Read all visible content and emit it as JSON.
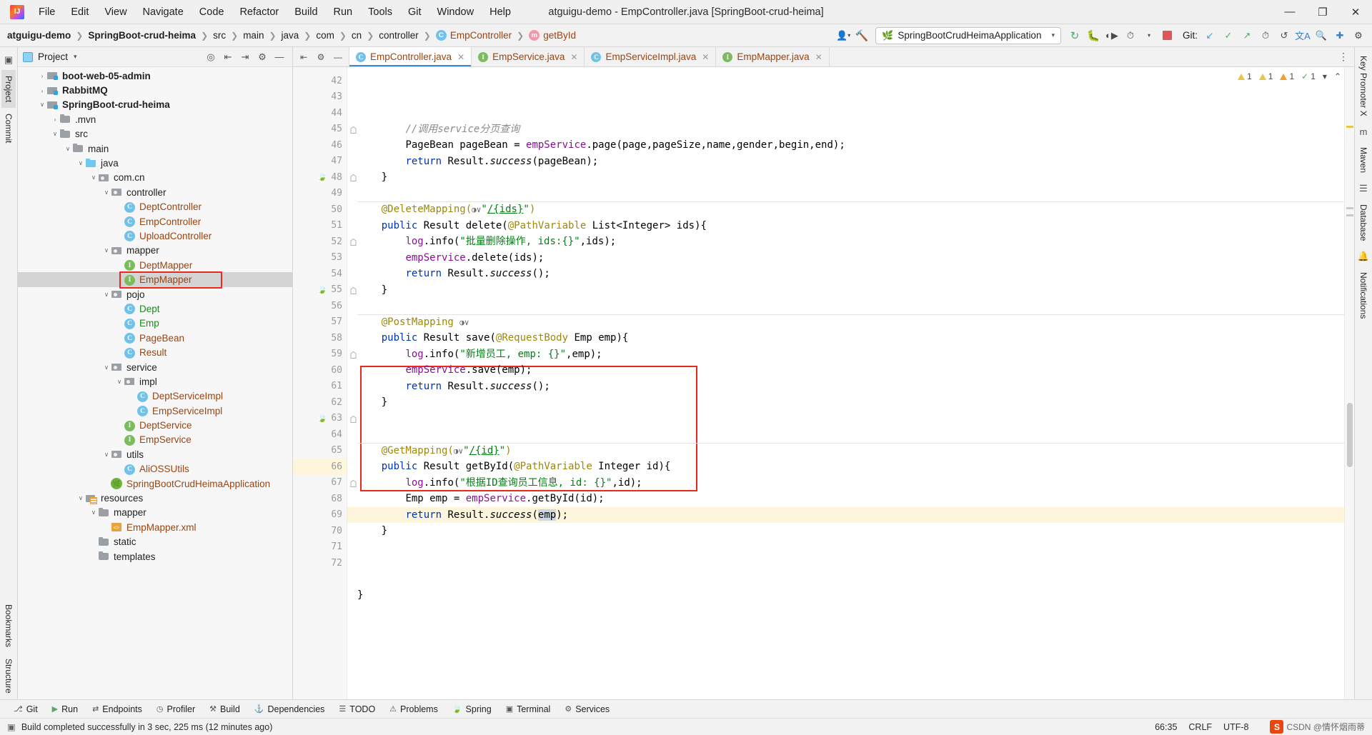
{
  "window": {
    "title": "atguigu-demo - EmpController.java [SpringBoot-crud-heima]",
    "minimize": "—",
    "maximize": "❐",
    "close": "✕"
  },
  "menubar": [
    {
      "label": "File"
    },
    {
      "label": "Edit"
    },
    {
      "label": "View"
    },
    {
      "label": "Navigate"
    },
    {
      "label": "Code"
    },
    {
      "label": "Refactor"
    },
    {
      "label": "Build"
    },
    {
      "label": "Run"
    },
    {
      "label": "Tools"
    },
    {
      "label": "Git"
    },
    {
      "label": "Window"
    },
    {
      "label": "Help"
    }
  ],
  "breadcrumb": [
    {
      "label": "atguigu-demo",
      "bold": true,
      "badge": ""
    },
    {
      "label": "SpringBoot-crud-heima",
      "bold": true,
      "badge": ""
    },
    {
      "label": "src",
      "bold": false,
      "badge": ""
    },
    {
      "label": "main",
      "bold": false,
      "badge": ""
    },
    {
      "label": "java",
      "bold": false,
      "badge": ""
    },
    {
      "label": "com",
      "bold": false,
      "badge": ""
    },
    {
      "label": "cn",
      "bold": false,
      "badge": ""
    },
    {
      "label": "controller",
      "bold": false,
      "badge": ""
    },
    {
      "label": "EmpController",
      "bold": false,
      "badge": "C"
    },
    {
      "label": "getById",
      "bold": false,
      "badge": "m"
    }
  ],
  "toolbar": {
    "run_config": "SpringBootCrudHeimaApplication",
    "git_label": "Git:",
    "icons": {
      "user": "user-icon",
      "hammer": "build-icon",
      "rerun": "rerun-icon",
      "debug": "debug-icon",
      "coverage": "coverage-icon",
      "profiler": "profiler-icon",
      "stop": "stop-icon",
      "update": "git-update-icon",
      "commit": "git-commit-icon",
      "push": "git-push-icon",
      "history": "git-history-icon",
      "rollback": "git-rollback-icon",
      "translate": "translate-icon",
      "search": "search-icon",
      "plugin": "plugins-icon",
      "settings": "settings-icon"
    }
  },
  "left_rail": [
    "Project",
    "Commit"
  ],
  "right_rail": [
    "Key Promoter X",
    "Maven",
    "Database",
    "Notifications"
  ],
  "bottom_rail": [
    "Bookmarks",
    "Structure"
  ],
  "project_panel": {
    "title": "Project",
    "tree": [
      {
        "depth": 1,
        "arrow": "›",
        "icon": "module",
        "label": "boot-web-05-admin",
        "style": "b"
      },
      {
        "depth": 1,
        "arrow": "›",
        "icon": "module",
        "label": "RabbitMQ",
        "style": "b"
      },
      {
        "depth": 1,
        "arrow": "∨",
        "icon": "module",
        "label": "SpringBoot-crud-heima",
        "style": "b"
      },
      {
        "depth": 2,
        "arrow": "›",
        "icon": "folder",
        "label": ".mvn",
        "style": ""
      },
      {
        "depth": 2,
        "arrow": "∨",
        "icon": "folder",
        "label": "src",
        "style": ""
      },
      {
        "depth": 3,
        "arrow": "∨",
        "icon": "folder",
        "label": "main",
        "style": ""
      },
      {
        "depth": 4,
        "arrow": "∨",
        "icon": "folder-blue",
        "label": "java",
        "style": ""
      },
      {
        "depth": 5,
        "arrow": "∨",
        "icon": "package",
        "label": "com.cn",
        "style": ""
      },
      {
        "depth": 6,
        "arrow": "∨",
        "icon": "package",
        "label": "controller",
        "style": ""
      },
      {
        "depth": 7,
        "arrow": "",
        "icon": "class",
        "label": "DeptController",
        "style": "orange"
      },
      {
        "depth": 7,
        "arrow": "",
        "icon": "class",
        "label": "EmpController",
        "style": "orange"
      },
      {
        "depth": 7,
        "arrow": "",
        "icon": "class",
        "label": "UploadController",
        "style": "orange"
      },
      {
        "depth": 6,
        "arrow": "∨",
        "icon": "package",
        "label": "mapper",
        "style": ""
      },
      {
        "depth": 7,
        "arrow": "",
        "icon": "interface",
        "label": "DeptMapper",
        "style": "orange"
      },
      {
        "depth": 7,
        "arrow": "",
        "icon": "interface",
        "label": "EmpMapper",
        "style": "orange",
        "selected": true,
        "boxed": true
      },
      {
        "depth": 6,
        "arrow": "∨",
        "icon": "package",
        "label": "pojo",
        "style": ""
      },
      {
        "depth": 7,
        "arrow": "",
        "icon": "class",
        "label": "Dept",
        "style": "green"
      },
      {
        "depth": 7,
        "arrow": "",
        "icon": "class",
        "label": "Emp",
        "style": "green"
      },
      {
        "depth": 7,
        "arrow": "",
        "icon": "class",
        "label": "PageBean",
        "style": "orange"
      },
      {
        "depth": 7,
        "arrow": "",
        "icon": "class",
        "label": "Result",
        "style": "orange"
      },
      {
        "depth": 6,
        "arrow": "∨",
        "icon": "package",
        "label": "service",
        "style": ""
      },
      {
        "depth": 7,
        "arrow": "∨",
        "icon": "package",
        "label": "impl",
        "style": ""
      },
      {
        "depth": 8,
        "arrow": "",
        "icon": "class",
        "label": "DeptServiceImpl",
        "style": "orange"
      },
      {
        "depth": 8,
        "arrow": "",
        "icon": "class",
        "label": "EmpServiceImpl",
        "style": "orange"
      },
      {
        "depth": 7,
        "arrow": "",
        "icon": "interface",
        "label": "DeptService",
        "style": "orange"
      },
      {
        "depth": 7,
        "arrow": "",
        "icon": "interface",
        "label": "EmpService",
        "style": "orange"
      },
      {
        "depth": 6,
        "arrow": "∨",
        "icon": "package",
        "label": "utils",
        "style": ""
      },
      {
        "depth": 7,
        "arrow": "",
        "icon": "class",
        "label": "AliOSSUtils",
        "style": "orange"
      },
      {
        "depth": 6,
        "arrow": "",
        "icon": "spring-app",
        "label": "SpringBootCrudHeimaApplication",
        "style": "orange"
      },
      {
        "depth": 4,
        "arrow": "∨",
        "icon": "resources",
        "label": "resources",
        "style": ""
      },
      {
        "depth": 5,
        "arrow": "∨",
        "icon": "folder",
        "label": "mapper",
        "style": ""
      },
      {
        "depth": 6,
        "arrow": "",
        "icon": "xml",
        "label": "EmpMapper.xml",
        "style": "orange"
      },
      {
        "depth": 5,
        "arrow": "",
        "icon": "folder",
        "label": "static",
        "style": ""
      },
      {
        "depth": 5,
        "arrow": "",
        "icon": "folder",
        "label": "templates",
        "style": ""
      }
    ]
  },
  "editor": {
    "tabs": [
      {
        "label": "EmpController.java",
        "badge": "C",
        "badge_type": "class",
        "active": true
      },
      {
        "label": "EmpService.java",
        "badge": "I",
        "badge_type": "interface",
        "active": false
      },
      {
        "label": "EmpServiceImpl.java",
        "badge": "C",
        "badge_type": "class",
        "active": false
      },
      {
        "label": "EmpMapper.java",
        "badge": "I",
        "badge_type": "interface",
        "active": false
      }
    ],
    "inspection": {
      "warnings": "1",
      "weak_warnings": "1",
      "typos": "1",
      "checks": "1"
    },
    "first_line": 42,
    "lines": [
      {
        "n": 42,
        "indent": 8,
        "tokens": [
          {
            "t": "//调用service分页查询",
            "c": "cmt"
          }
        ]
      },
      {
        "n": 43,
        "indent": 8,
        "tokens": [
          {
            "t": "PageBean pageBean = ",
            "c": ""
          },
          {
            "t": "empService",
            "c": "fld"
          },
          {
            "t": ".page(page,pageSize,name,gender,begin,end);",
            "c": ""
          }
        ]
      },
      {
        "n": 44,
        "indent": 8,
        "tokens": [
          {
            "t": "return ",
            "c": "kw"
          },
          {
            "t": "Result.",
            "c": ""
          },
          {
            "t": "success",
            "c": "ital"
          },
          {
            "t": "(pageBean);",
            "c": ""
          }
        ]
      },
      {
        "n": 45,
        "indent": 4,
        "tokens": [
          {
            "t": "}",
            "c": ""
          }
        ],
        "fold": true
      },
      {
        "n": 46,
        "indent": 0,
        "tokens": []
      },
      {
        "n": 47,
        "indent": 4,
        "sep": true,
        "tokens": [
          {
            "t": "@DeleteMapping(",
            "c": "ann"
          },
          {
            "t": "◑∨",
            "c": "globe"
          },
          {
            "t": "\"",
            "c": "str"
          },
          {
            "t": "/{ids}",
            "c": "link"
          },
          {
            "t": "\"",
            "c": "str"
          },
          {
            "t": ")",
            "c": "ann"
          }
        ]
      },
      {
        "n": 48,
        "indent": 4,
        "gm": true,
        "fold2": true,
        "tokens": [
          {
            "t": "public ",
            "c": "kw"
          },
          {
            "t": "Result delete(",
            "c": ""
          },
          {
            "t": "@PathVariable",
            "c": "ann"
          },
          {
            "t": " List<Integer> ids){",
            "c": ""
          }
        ]
      },
      {
        "n": 49,
        "indent": 8,
        "tokens": [
          {
            "t": "log",
            "c": "fld"
          },
          {
            "t": ".info(",
            "c": ""
          },
          {
            "t": "\"批量删除操作, ids:{}\"",
            "c": "str"
          },
          {
            "t": ",ids);",
            "c": ""
          }
        ]
      },
      {
        "n": 50,
        "indent": 8,
        "tokens": [
          {
            "t": "empService",
            "c": "fld"
          },
          {
            "t": ".delete(ids);",
            "c": ""
          }
        ]
      },
      {
        "n": 51,
        "indent": 8,
        "tokens": [
          {
            "t": "return ",
            "c": "kw"
          },
          {
            "t": "Result.",
            "c": ""
          },
          {
            "t": "success",
            "c": "ital"
          },
          {
            "t": "();",
            "c": ""
          }
        ]
      },
      {
        "n": 52,
        "indent": 4,
        "tokens": [
          {
            "t": "}",
            "c": ""
          }
        ],
        "fold": true
      },
      {
        "n": 53,
        "indent": 0,
        "tokens": []
      },
      {
        "n": 54,
        "indent": 4,
        "sep": true,
        "tokens": [
          {
            "t": "@PostMapping ",
            "c": "ann"
          },
          {
            "t": "◑∨",
            "c": "globe"
          }
        ]
      },
      {
        "n": 55,
        "indent": 4,
        "gm": true,
        "fold2": true,
        "tokens": [
          {
            "t": "public ",
            "c": "kw"
          },
          {
            "t": "Result save(",
            "c": ""
          },
          {
            "t": "@RequestBody",
            "c": "ann"
          },
          {
            "t": " Emp emp){",
            "c": ""
          }
        ]
      },
      {
        "n": 56,
        "indent": 8,
        "tokens": [
          {
            "t": "log",
            "c": "fld"
          },
          {
            "t": ".info(",
            "c": ""
          },
          {
            "t": "\"新增员工, emp: {}\"",
            "c": "str"
          },
          {
            "t": ",emp);",
            "c": ""
          }
        ]
      },
      {
        "n": 57,
        "indent": 8,
        "tokens": [
          {
            "t": "empService",
            "c": "fld"
          },
          {
            "t": ".save(emp);",
            "c": ""
          }
        ]
      },
      {
        "n": 58,
        "indent": 8,
        "tokens": [
          {
            "t": "return ",
            "c": "kw"
          },
          {
            "t": "Result.",
            "c": ""
          },
          {
            "t": "success",
            "c": "ital"
          },
          {
            "t": "();",
            "c": ""
          }
        ]
      },
      {
        "n": 59,
        "indent": 4,
        "tokens": [
          {
            "t": "}",
            "c": ""
          }
        ],
        "fold": true
      },
      {
        "n": 60,
        "indent": 0,
        "tokens": []
      },
      {
        "n": 61,
        "indent": 0,
        "tokens": []
      },
      {
        "n": 62,
        "indent": 4,
        "sep": true,
        "tokens": [
          {
            "t": "@GetMapping(",
            "c": "ann"
          },
          {
            "t": "◑∨",
            "c": "globe"
          },
          {
            "t": "\"",
            "c": "str"
          },
          {
            "t": "/{id}",
            "c": "link"
          },
          {
            "t": "\"",
            "c": "str"
          },
          {
            "t": ")",
            "c": "ann"
          }
        ]
      },
      {
        "n": 63,
        "indent": 4,
        "gm": true,
        "fold2": true,
        "tokens": [
          {
            "t": "public ",
            "c": "kw"
          },
          {
            "t": "Result getById(",
            "c": ""
          },
          {
            "t": "@PathVariable",
            "c": "ann"
          },
          {
            "t": " Integer id){",
            "c": ""
          }
        ]
      },
      {
        "n": 64,
        "indent": 8,
        "tokens": [
          {
            "t": "log",
            "c": "fld"
          },
          {
            "t": ".info(",
            "c": ""
          },
          {
            "t": "\"根据ID查询员工信息, id: {}\"",
            "c": "str"
          },
          {
            "t": ",id);",
            "c": ""
          }
        ]
      },
      {
        "n": 65,
        "indent": 8,
        "tokens": [
          {
            "t": "Emp emp = ",
            "c": ""
          },
          {
            "t": "empService",
            "c": "fld"
          },
          {
            "t": ".getById(id);",
            "c": ""
          }
        ]
      },
      {
        "n": 66,
        "indent": 8,
        "hl": true,
        "tokens": [
          {
            "t": "return ",
            "c": "kw"
          },
          {
            "t": "Result.",
            "c": ""
          },
          {
            "t": "success",
            "c": "ital"
          },
          {
            "t": "(",
            "c": ""
          },
          {
            "t": "emp",
            "c": "sel-tok"
          },
          {
            "t": ");",
            "c": ""
          }
        ]
      },
      {
        "n": 67,
        "indent": 4,
        "tokens": [
          {
            "t": "}",
            "c": ""
          }
        ],
        "fold": true
      },
      {
        "n": 68,
        "indent": 0,
        "tokens": []
      },
      {
        "n": 69,
        "indent": 0,
        "tokens": []
      },
      {
        "n": 70,
        "indent": 0,
        "tokens": []
      },
      {
        "n": 71,
        "indent": 0,
        "tokens": [
          {
            "t": "}",
            "c": ""
          }
        ]
      },
      {
        "n": 72,
        "indent": 0,
        "tokens": []
      }
    ]
  },
  "bottom_toolwindows": [
    {
      "label": "Git",
      "icon": "git-icon"
    },
    {
      "label": "Run",
      "icon": "run-icon"
    },
    {
      "label": "Endpoints",
      "icon": "endpoints-icon"
    },
    {
      "label": "Profiler",
      "icon": "profiler-icon"
    },
    {
      "label": "Build",
      "icon": "build-icon"
    },
    {
      "label": "Dependencies",
      "icon": "dependencies-icon"
    },
    {
      "label": "TODO",
      "icon": "todo-icon"
    },
    {
      "label": "Problems",
      "icon": "problems-icon"
    },
    {
      "label": "Spring",
      "icon": "spring-icon"
    },
    {
      "label": "Terminal",
      "icon": "terminal-icon"
    },
    {
      "label": "Services",
      "icon": "services-icon"
    }
  ],
  "statusbar": {
    "message": "Build completed successfully in 3 sec, 225 ms (12 minutes ago)",
    "caret": "66:35",
    "line_sep": "CRLF",
    "encoding": "UTF-8",
    "watermark": "CSDN @情怀烟雨蒂"
  },
  "colors": {
    "accent": "#3e87d4",
    "highlight_box": "#e8291c",
    "keyword": "#0033b3",
    "string": "#067d17",
    "annotation": "#9e880d",
    "field": "#871094",
    "comment": "#8c8c8c",
    "class_badge": "#72c2e8",
    "interface_badge": "#7cbb5e",
    "method_badge": "#ef9aab",
    "spring_green": "#6db33f",
    "run_green": "#59a869",
    "stop_red": "#e05555"
  }
}
